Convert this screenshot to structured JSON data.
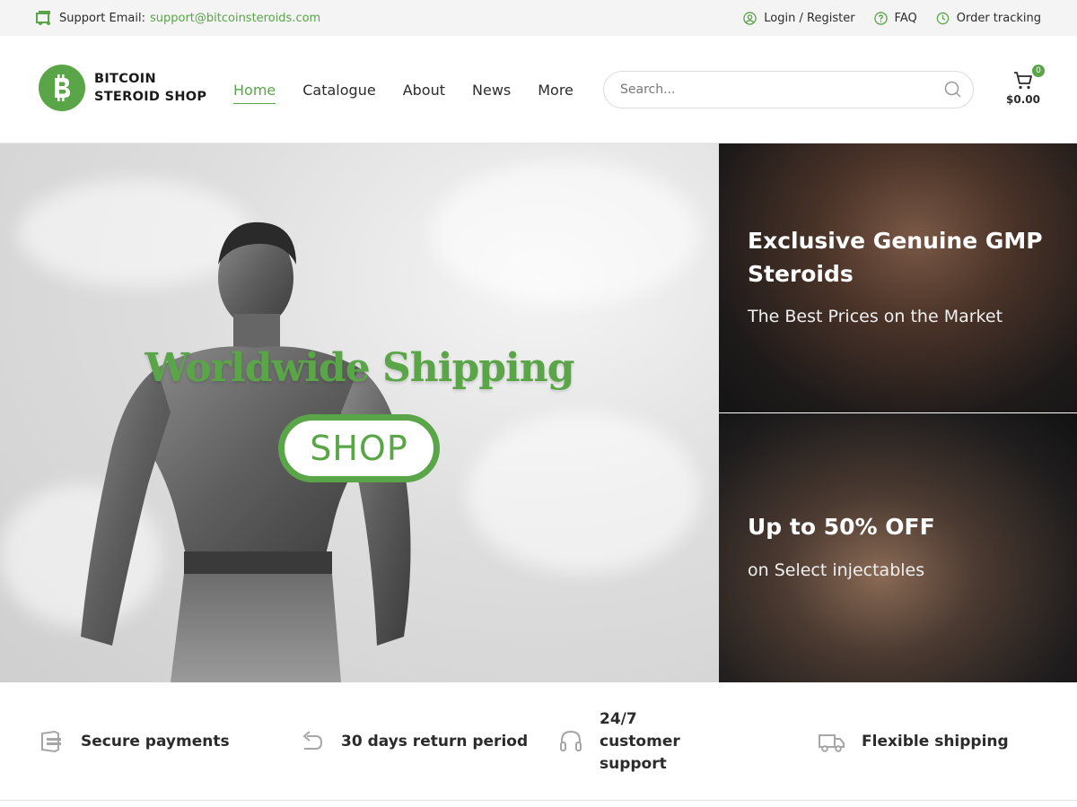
{
  "topbar": {
    "support_label": "Support Email:",
    "support_email": "support@bitcoinsteroids.com",
    "login": "Login / Register",
    "faq": "FAQ",
    "order_tracking": "Order tracking"
  },
  "brand": {
    "line1": "BITCOIN",
    "line2": "STEROID SHOP",
    "accent_color": "#5aa548"
  },
  "nav": {
    "home": "Home",
    "catalogue": "Catalogue",
    "about": "About",
    "news": "News",
    "more": "More"
  },
  "search": {
    "placeholder": "Search..."
  },
  "cart": {
    "count": "0",
    "total": "$0.00"
  },
  "hero": {
    "headline": "Worldwide Shipping",
    "button": "SHOP"
  },
  "promos": [
    {
      "title": "Exclusive Genuine GMP Steroids",
      "subtitle": "The Best Prices on the Market"
    },
    {
      "title": "Up to 50% OFF",
      "subtitle": "on Select injectables"
    }
  ],
  "features": [
    {
      "label": "Secure payments",
      "icon": "card-icon"
    },
    {
      "label": "30 days return period",
      "icon": "return-icon"
    },
    {
      "label": "24/7 customer support",
      "icon": "headset-icon"
    },
    {
      "label": "Flexible shipping",
      "icon": "truck-icon"
    }
  ]
}
